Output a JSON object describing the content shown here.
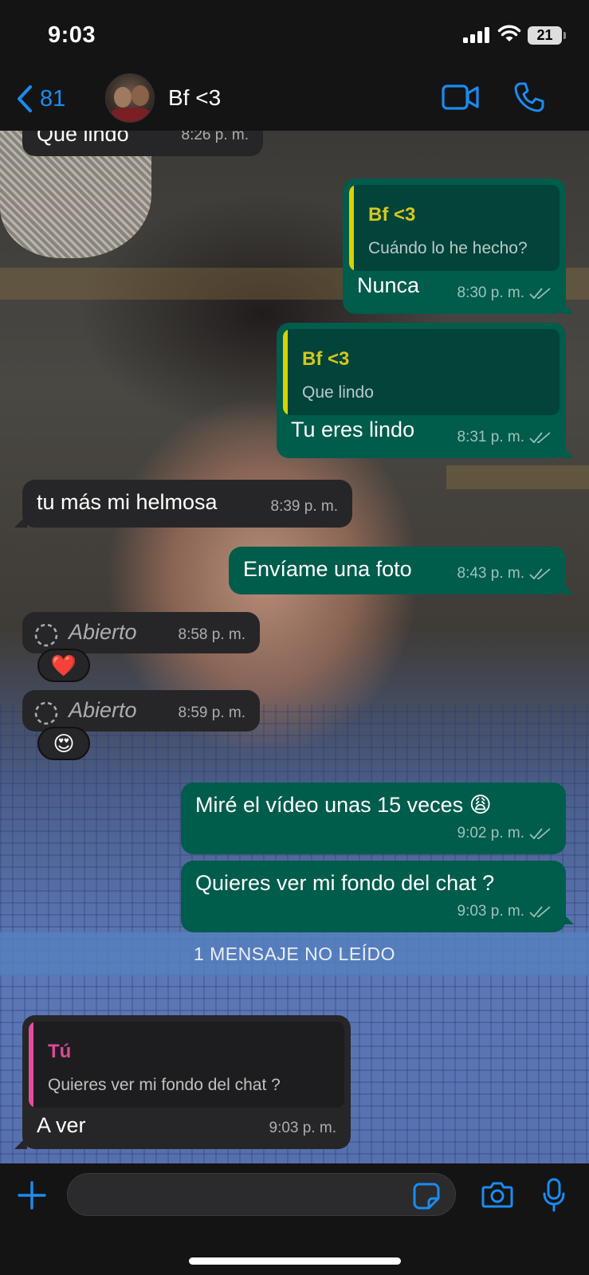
{
  "status_bar": {
    "time": "9:03",
    "battery": "21"
  },
  "header": {
    "back_count": "81",
    "contact_name": "Bf <3"
  },
  "messages": {
    "m0": {
      "text": "Que lindo",
      "time": "8:26 p. m."
    },
    "m1": {
      "quote_author": "Bf <3",
      "quote_text": "Cuándo lo he hecho?",
      "text": "Nunca",
      "time": "8:30 p. m."
    },
    "m2": {
      "quote_author": "Bf <3",
      "quote_text": "Que lindo",
      "text": "Tu eres lindo",
      "time": "8:31 p. m."
    },
    "m3": {
      "text": "tu más mi helmosa",
      "time": "8:39 p. m."
    },
    "m4": {
      "text": "Envíame una foto",
      "time": "8:43 p. m."
    },
    "m5": {
      "label": "Abierto",
      "time": "8:58 p. m.",
      "reaction": "❤️"
    },
    "m6": {
      "label": "Abierto",
      "time": "8:59 p. m.",
      "reaction": "😍"
    },
    "m7": {
      "text": "Miré el vídeo unas 15 veces 😩",
      "time": "9:02 p. m."
    },
    "m8": {
      "text": "Quieres ver mi fondo del chat ?",
      "time": "9:03 p. m."
    },
    "unread_banner": "1 MENSAJE NO LEÍDO",
    "m9": {
      "quote_author": "Tú",
      "quote_text": "Quieres ver mi fondo del chat ?",
      "text": "A ver",
      "time": "9:03 p. m."
    }
  },
  "input": {
    "placeholder": ""
  },
  "icons": {
    "back": "chevron-left-icon",
    "video": "video-camera-icon",
    "call": "phone-icon",
    "plus": "plus-icon",
    "sticker": "sticker-icon",
    "camera": "camera-icon",
    "mic": "microphone-icon",
    "read": "double-check-icon",
    "view_once": "view-once-icon"
  },
  "colors": {
    "accent": "#1a8cf2",
    "outgoing_bubble": "#005c4b",
    "incoming_bubble": "#262628",
    "quote_bar_contact": "#d8d300",
    "quote_bar_self": "#e44d9a"
  }
}
